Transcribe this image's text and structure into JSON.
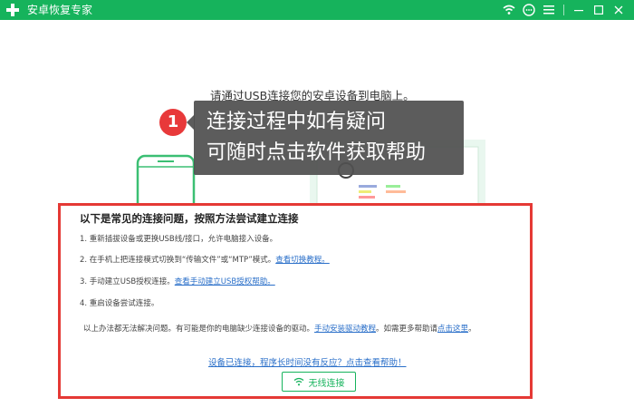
{
  "app": {
    "title": "安卓恢复专家"
  },
  "instruction": "请通过USB连接您的安卓设备到电脑上。",
  "tooltip": {
    "badge": "1",
    "line1": "连接过程中如有疑问",
    "line2": "可随时点击软件获取帮助"
  },
  "help": {
    "title": "以下是常见的连接问题，按照方法尝试建立连接",
    "steps": [
      {
        "text": "1.  重新插拔设备或更换USB线/接口，允许电脑接入设备。",
        "link": ""
      },
      {
        "text": "2.  在手机上把连接模式切换到“传输文件”或“MTP”模式。",
        "link": "查看切换教程。"
      },
      {
        "text": "3.  手动建立USB授权连接。",
        "link": "查看手动建立USB授权帮助。"
      },
      {
        "text": "4.  重启设备尝试连接。",
        "link": ""
      }
    ],
    "note": {
      "prefix": "以上办法都无法解决问题。有可能是你的电脑缺少连接设备的驱动。",
      "link1": "手动安装驱动教程",
      "middle": "。如需更多帮助请",
      "link2": "点击这里",
      "suffix": "。"
    },
    "bottom_link": "设备已连接，程序长时间没有反应？点击查看帮助！",
    "wireless_button": "无线连接"
  },
  "colors": {
    "brand": "#16b35c",
    "highlight": "#e53935",
    "link": "#2a6fc9"
  }
}
